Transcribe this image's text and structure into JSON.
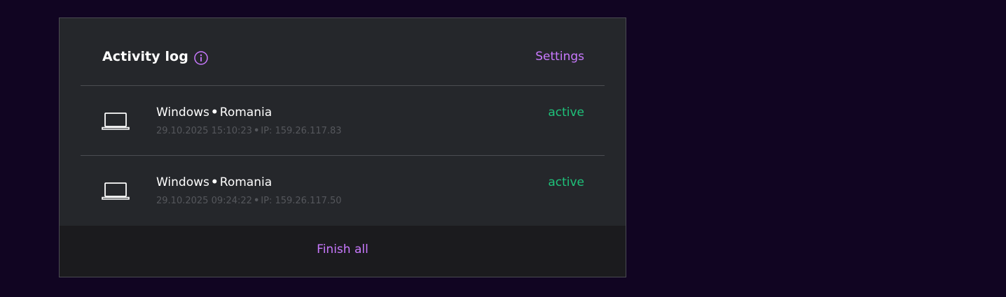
{
  "activity_log": {
    "title": "Activity log",
    "settings_label": "Settings",
    "sessions": [
      {
        "os": "Windows",
        "country": "Romania",
        "datetime": "29.10.2025 15:10:23",
        "ip": "IP: 159.26.117.83",
        "status": "active"
      },
      {
        "os": "Windows",
        "country": "Romania",
        "datetime": "29.10.2025 09:24:22",
        "ip": "IP: 159.26.117.50",
        "status": "active"
      }
    ],
    "finish_all_label": "Finish all"
  },
  "colors": {
    "background": "#110522",
    "panel": "#25272b",
    "footer": "#1b1b1e",
    "accent": "#c979ff",
    "status_active": "#1ec27a",
    "muted_text": "#55575c"
  },
  "icons": {
    "info": "info-icon",
    "device": "laptop-icon"
  }
}
